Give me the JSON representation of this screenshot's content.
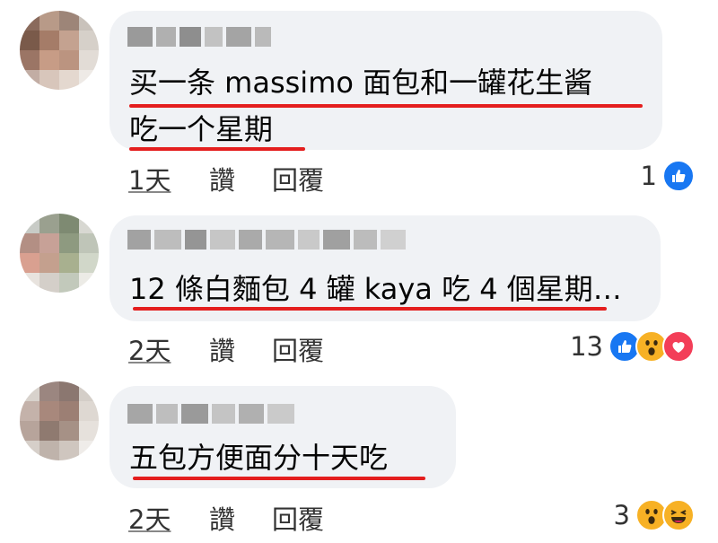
{
  "comments": [
    {
      "text_lines": [
        "买一条 massimo 面包和一罐花生酱",
        "吃一个星期"
      ],
      "time": "1天",
      "like_label": "讚",
      "reply_label": "回覆",
      "reaction_count": "1",
      "reactions": [
        "like-icon"
      ]
    },
    {
      "text_lines": [
        "12 條白麵包 4 罐 kaya 吃 4 個星期…"
      ],
      "time": "2天",
      "like_label": "讚",
      "reply_label": "回覆",
      "reaction_count": "13",
      "reactions": [
        "like-icon",
        "wow-icon",
        "love-icon"
      ]
    },
    {
      "text_lines": [
        "五包方便面分十天吃"
      ],
      "time": "2天",
      "like_label": "讚",
      "reply_label": "回覆",
      "reaction_count": "3",
      "reactions": [
        "wow-icon",
        "haha-icon"
      ]
    }
  ],
  "colors": {
    "bubble": "#f0f2f5",
    "underline": "#e41e1e",
    "like_blue": "#1877f2",
    "love_red": "#f33e58",
    "emoji_yellow": "#f7b125"
  }
}
